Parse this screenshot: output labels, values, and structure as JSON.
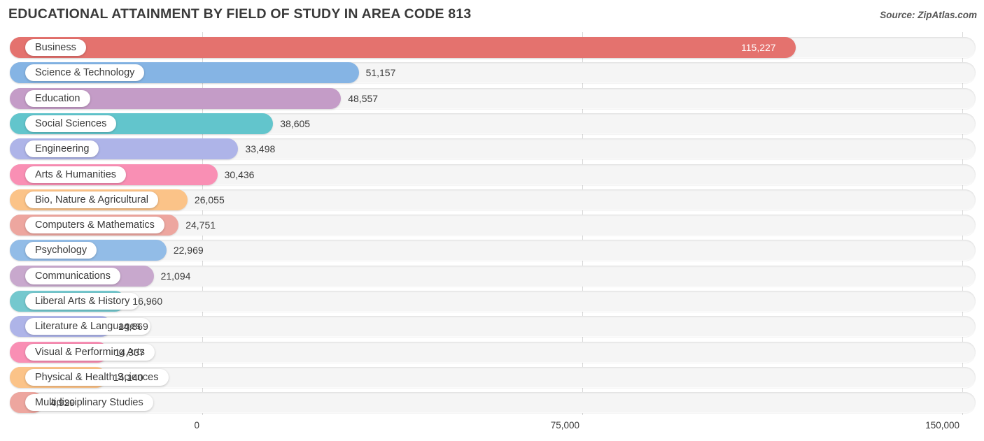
{
  "header": {
    "title": "EDUCATIONAL ATTAINMENT BY FIELD OF STUDY IN AREA CODE 813",
    "source": "Source: ZipAtlas.com"
  },
  "chart_data": {
    "type": "bar",
    "orientation": "horizontal",
    "title": "EDUCATIONAL ATTAINMENT BY FIELD OF STUDY IN AREA CODE 813",
    "xlabel": "",
    "ylabel": "",
    "xlim": [
      0,
      150000
    ],
    "xticks": [
      "0",
      "75,000",
      "150,000"
    ],
    "xtick_values": [
      0,
      75000,
      150000
    ],
    "grid": true,
    "legend": "none",
    "categories": [
      "Business",
      "Science & Technology",
      "Education",
      "Social Sciences",
      "Engineering",
      "Arts & Humanities",
      "Bio, Nature & Agricultural",
      "Computers & Mathematics",
      "Psychology",
      "Communications",
      "Liberal Arts & History",
      "Literature & Languages",
      "Visual & Performing Arts",
      "Physical & Health Sciences",
      "Multidisciplinary Studies"
    ],
    "values": [
      115227,
      51157,
      48557,
      38605,
      33498,
      30436,
      26055,
      24751,
      22969,
      21094,
      16960,
      14869,
      14337,
      14140,
      4929
    ],
    "value_labels": [
      "115,227",
      "51,157",
      "48,557",
      "38,605",
      "33,498",
      "30,436",
      "26,055",
      "24,751",
      "22,969",
      "21,094",
      "16,960",
      "14,869",
      "14,337",
      "14,140",
      "4,929"
    ],
    "colors": [
      "#e4726e",
      "#85b4e4",
      "#c49cc7",
      "#62c5cc",
      "#aeb4e8",
      "#f98fb4",
      "#fbc388",
      "#eda69f",
      "#92bce7",
      "#c8a8cd",
      "#74c8ce",
      "#aeb4e8",
      "#f98fb4",
      "#fbc388",
      "#eda69f"
    ]
  }
}
